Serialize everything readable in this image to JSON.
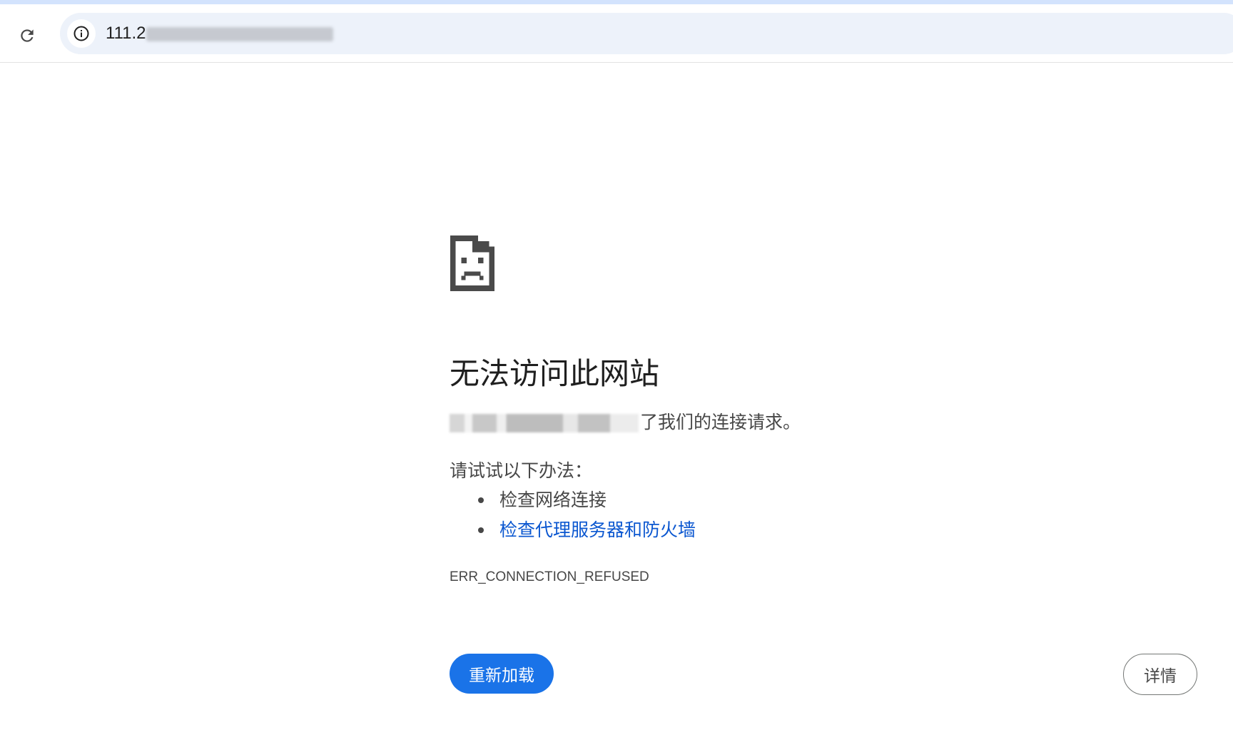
{
  "browser": {
    "url_visible_prefix": "111.2",
    "reload_icon": "reload-icon",
    "site_info_icon": "info-icon"
  },
  "error_page": {
    "icon": "sad-page-icon",
    "heading": "无法访问此网站",
    "summary_suffix": "了我们的连接请求。",
    "suggestions_title": "请试试以下办法：",
    "suggestions": [
      {
        "label": "检查网络连接",
        "is_link": false
      },
      {
        "label": "检查代理服务器和防火墙",
        "is_link": true
      }
    ],
    "error_code": "ERR_CONNECTION_REFUSED",
    "reload_label": "重新加载",
    "details_label": "详情"
  },
  "colors": {
    "primary_button": "#1a73e8",
    "link": "#0b57d0",
    "omnibox_bg": "#edf2fa"
  }
}
